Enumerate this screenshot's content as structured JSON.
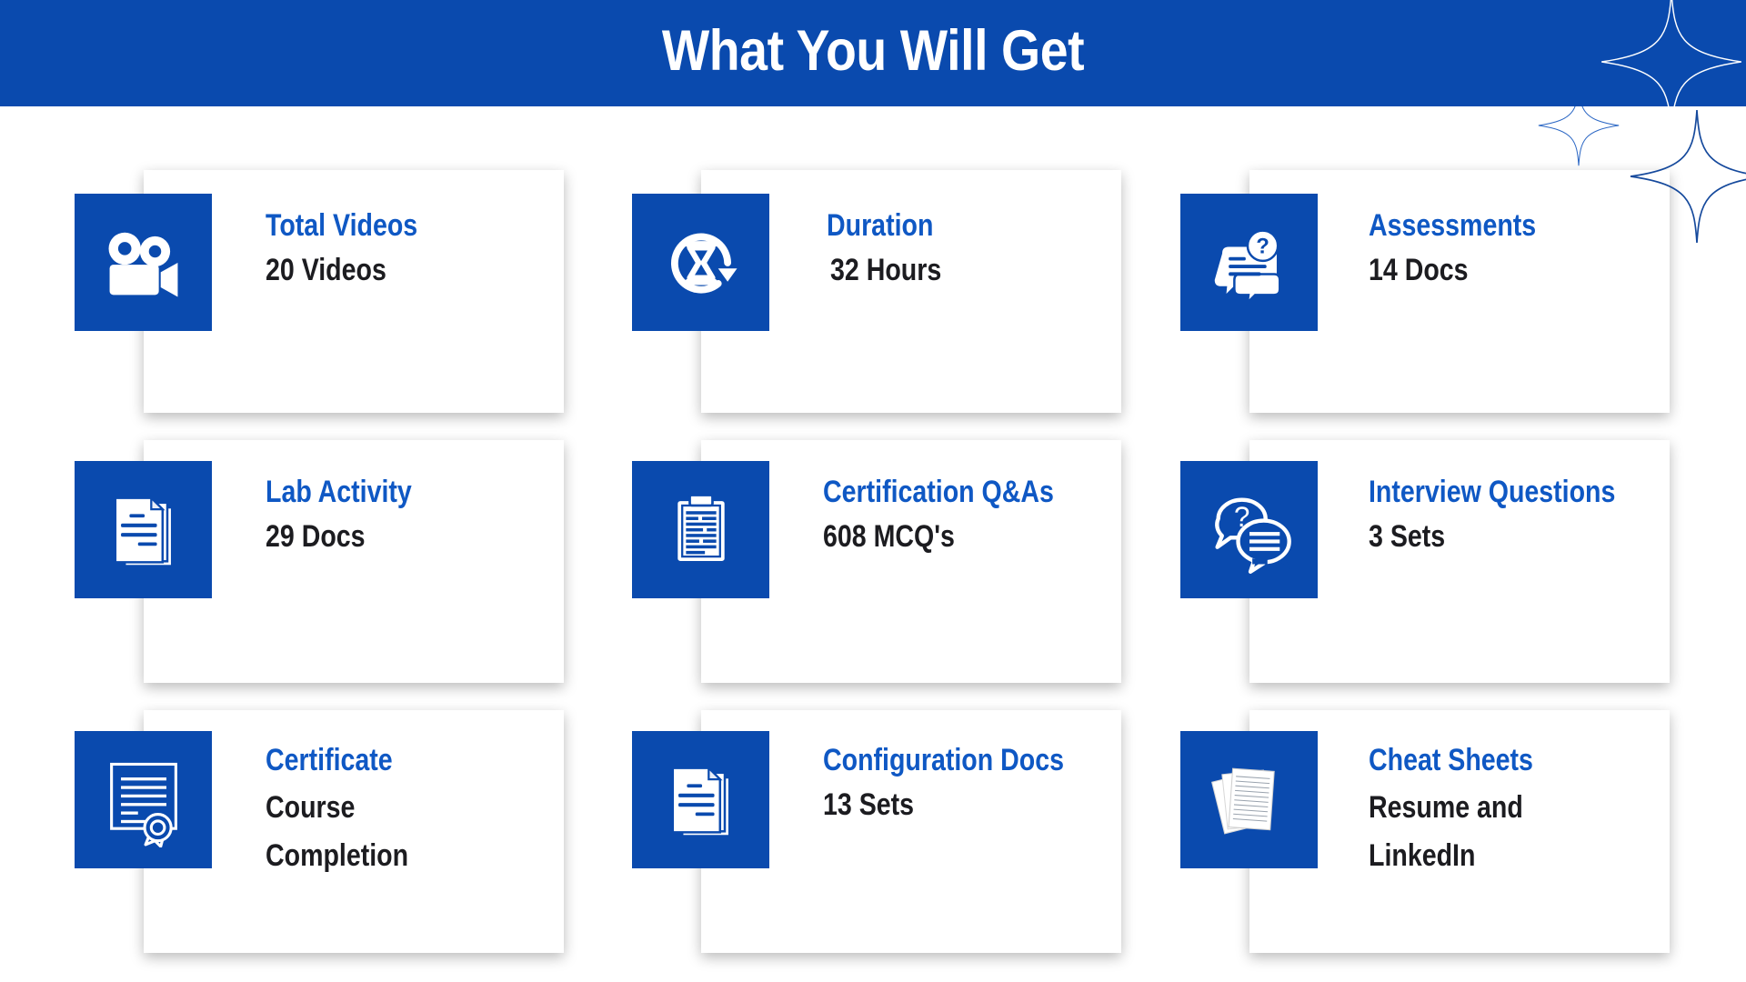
{
  "header": {
    "title": "What You Will Get",
    "background_color": "#0a4aae",
    "text_color": "#ffffff"
  },
  "theme": {
    "brand_blue": "#0a4aae",
    "title_blue": "#0f58c4",
    "value_dark": "#1c1c20",
    "card_background": "#ffffff",
    "page_background": "#ffffff"
  },
  "decorations": [
    {
      "name": "sparkle-large-top",
      "shape": "four-point-star-outline"
    },
    {
      "name": "sparkle-small",
      "shape": "four-point-star-outline"
    },
    {
      "name": "sparkle-large-bottom",
      "shape": "four-point-star-outline"
    }
  ],
  "cards": [
    {
      "title": "Total Videos",
      "value": "20 Videos",
      "icon": "video-camera-icon"
    },
    {
      "title": "Duration",
      "value": "32 Hours",
      "icon": "hourglass-refresh-icon"
    },
    {
      "title": "Assessments",
      "value": "14 Docs",
      "icon": "question-speech-bubble-icon"
    },
    {
      "title": "Lab Activity",
      "value": "29 Docs",
      "icon": "stacked-documents-icon"
    },
    {
      "title": "Certification Q&As",
      "value": "608 MCQ's",
      "icon": "clipboard-icon"
    },
    {
      "title": "Interview Questions",
      "value": "3 Sets",
      "icon": "chat-bubbles-icon"
    },
    {
      "title": "Certificate",
      "value": "Course\nCompletion",
      "icon": "certificate-ribbon-icon"
    },
    {
      "title": "Configuration Docs",
      "value": "13 Sets",
      "icon": "stacked-documents-icon"
    },
    {
      "title": "Cheat Sheets",
      "value": "Resume and\nLinkedIn",
      "icon": "lined-papers-icon"
    }
  ]
}
